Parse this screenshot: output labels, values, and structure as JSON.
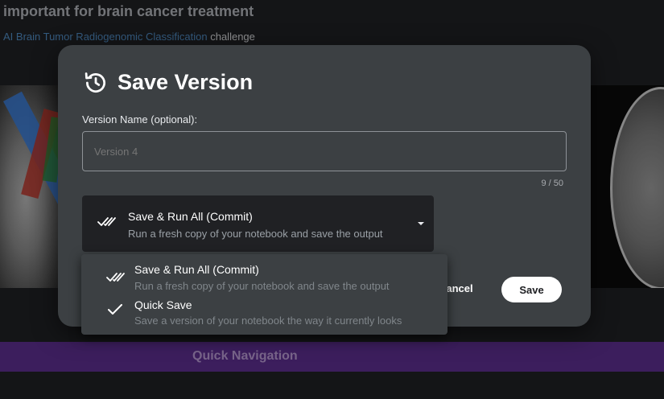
{
  "background": {
    "heading": "important for brain cancer treatment",
    "challenge_link": "AI Brain Tumor Radiogenomic Classification",
    "challenge_suffix": " challenge",
    "quick_nav_label": "Quick Navigation"
  },
  "modal": {
    "title": "Save Version",
    "title_icon": "history-icon",
    "version_name_label": "Version Name (optional):",
    "version_name_value": "",
    "version_name_placeholder": "Version 4",
    "char_count": "9 / 50",
    "selected_option": {
      "icon": "double-check-icon",
      "title": "Save & Run All (Commit)",
      "description": "Run a fresh copy of your notebook and save the output"
    },
    "cancel_label": "Cancel",
    "save_label": "Save"
  },
  "dropdown": {
    "options": [
      {
        "icon": "double-check-icon",
        "title": "Save & Run All (Commit)",
        "description": "Run a fresh copy of your notebook and save the output"
      },
      {
        "icon": "check-icon",
        "title": "Quick Save",
        "description": "Save a version of your notebook the way it currently looks"
      }
    ]
  },
  "colors": {
    "page_bg": "#202124",
    "modal_bg": "#3c4043",
    "link": "#4f8ac2",
    "quick_nav_bg": "#5d2f8f"
  }
}
